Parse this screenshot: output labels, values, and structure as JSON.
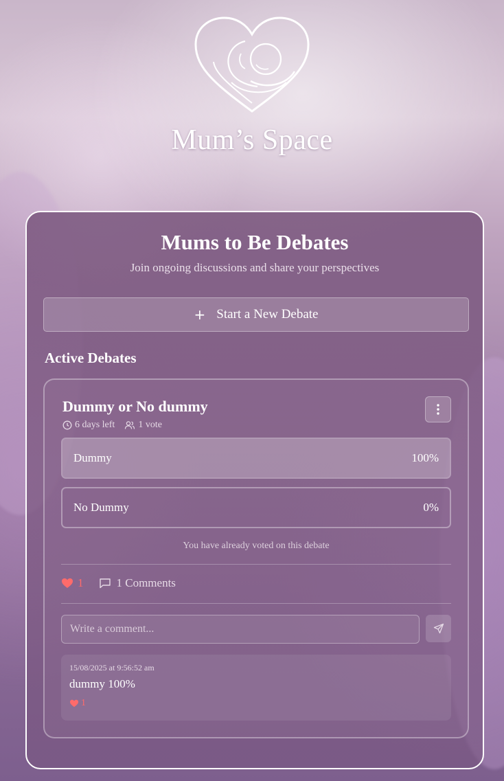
{
  "brand": {
    "name": "Mum’s Space"
  },
  "page": {
    "title": "Mums to Be Debates",
    "subtitle": "Join ongoing discussions and share your perspectives",
    "new_debate_label": "Start a New Debate",
    "section_heading": "Active Debates"
  },
  "debate": {
    "title": "Dummy or No dummy",
    "time_left": "6 days left",
    "votes": "1 vote",
    "options": [
      {
        "label": "Dummy",
        "percent_text": "100%",
        "percent": 100
      },
      {
        "label": "No Dummy",
        "percent_text": "0%",
        "percent": 0
      }
    ],
    "voted_note": "You have already voted on this debate",
    "likes": "1",
    "comments_label": "1 Comments",
    "comment_placeholder": "Write a comment...",
    "comments": [
      {
        "timestamp": "15/08/2025 at 9:56:52 am",
        "text": "dummy 100%",
        "likes": "1"
      }
    ]
  },
  "colors": {
    "accent_heart": "#ff6b6b",
    "panel_border": "#ffffff"
  },
  "icons": [
    "heart-logo-icon",
    "plus-icon",
    "clock-icon",
    "users-icon",
    "more-vertical-icon",
    "heart-icon",
    "comment-icon",
    "send-icon"
  ]
}
